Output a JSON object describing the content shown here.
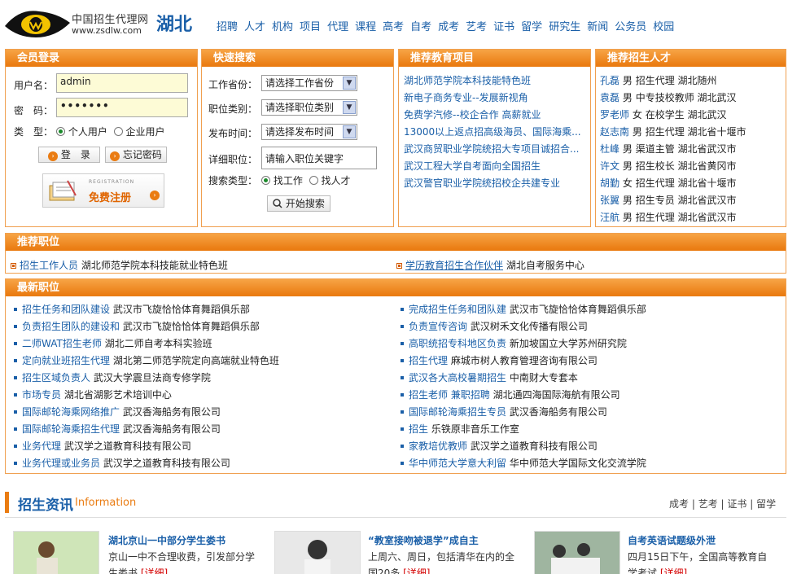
{
  "header": {
    "site_name": "中国招生代理网",
    "url": "www.zsdlw.com",
    "region": "湖北",
    "nav": [
      "招聘",
      "人才",
      "机构",
      "项目",
      "代理",
      "课程",
      "高考",
      "自考",
      "成考",
      "艺考",
      "证书",
      "留学",
      "研究生",
      "新闻",
      "公务员",
      "校园"
    ]
  },
  "login": {
    "title": "会员登录",
    "username_label": "用户名：",
    "username_value": "admin",
    "password_label": "密　码：",
    "password_value": "•••••••",
    "type_label": "类　型：",
    "type_personal": "个人用户",
    "type_company": "企业用户",
    "login_button": "登　录",
    "forgot_button": "忘记密码",
    "register_small": "REGISTRATION",
    "register_label": "免费注册"
  },
  "quick_search": {
    "title": "快速搜索",
    "province_label": "工作省份：",
    "province_value": "请选择工作省份",
    "category_label": "职位类别：",
    "category_value": "请选择职位类别",
    "time_label": "发布时间：",
    "time_value": "请选择发布时间",
    "job_label": "详细职位：",
    "job_placeholder": "请输入职位关键字",
    "type_label": "搜索类型：",
    "type_job": "找工作",
    "type_talent": "找人才",
    "search_button": "开始搜索"
  },
  "edu_projects": {
    "title": "推荐教育项目",
    "items": [
      "湖北师范学院本科技能特色班",
      "新电子商务专业--发展新视角",
      "免费学汽修--校企合作 高薪就业",
      "13000以上返点招高级海员、国际海乘...",
      "武汉商贸职业学院统招大专项目诚招合...",
      "武汉工程大学自考面向全国招生",
      "武汉警官职业学院统招校企共建专业"
    ]
  },
  "talents": {
    "title": "推荐招生人才",
    "items": [
      {
        "name": "孔磊",
        "gender": "男",
        "role": "招生代理",
        "loc": "湖北随州"
      },
      {
        "name": "袁磊",
        "gender": "男",
        "role": "中专技校教师",
        "loc": "湖北武汉"
      },
      {
        "name": "罗老师",
        "gender": "女",
        "role": "在校学生",
        "loc": "湖北武汉"
      },
      {
        "name": "赵志南",
        "gender": "男",
        "role": "招生代理",
        "loc": "湖北省十堰市"
      },
      {
        "name": "杜峰",
        "gender": "男",
        "role": "渠道主管",
        "loc": "湖北省武汉市"
      },
      {
        "name": "许文",
        "gender": "男",
        "role": "招生校长",
        "loc": "湖北省黄冈市"
      },
      {
        "name": "胡勤",
        "gender": "女",
        "role": "招生代理",
        "loc": "湖北省十堰市"
      },
      {
        "name": "张翼",
        "gender": "男",
        "role": "招生专员",
        "loc": "湖北省武汉市"
      },
      {
        "name": "汪航",
        "gender": "男",
        "role": "招生代理",
        "loc": "湖北省武汉市"
      }
    ]
  },
  "recommended_jobs": {
    "title": "推荐职位",
    "items": [
      {
        "job": "招生工作人员",
        "org": "湖北师范学院本科技能就业特色班"
      },
      {
        "job": "学历教育招生合作伙伴",
        "org": "湖北自考服务中心"
      }
    ]
  },
  "latest_jobs": {
    "title": "最新职位",
    "left": [
      {
        "job": "招生任务和团队建设",
        "org": "武汉市飞旋恰恰体育舞蹈俱乐部"
      },
      {
        "job": "负责招生团队的建设和",
        "org": "武汉市飞旋恰恰体育舞蹈俱乐部"
      },
      {
        "job": "二师WAT招生老师",
        "org": "湖北二师自考本科实验班"
      },
      {
        "job": "定向就业班招生代理",
        "org": "湖北第二师范学院定向高端就业特色班"
      },
      {
        "job": "招生区域负责人",
        "org": "武汉大学震旦法商专修学院"
      },
      {
        "job": "市场专员",
        "org": "湖北省湖影艺术培训中心"
      },
      {
        "job": "国际邮轮海乘网络推广",
        "org": "武汉香海船务有限公司"
      },
      {
        "job": "国际邮轮海乘招生代理",
        "org": "武汉香海船务有限公司"
      },
      {
        "job": "业务代理",
        "org": "武汉学之道教育科技有限公司"
      },
      {
        "job": "业务代理或业务员",
        "org": "武汉学之道教育科技有限公司"
      }
    ],
    "right": [
      {
        "job": "完成招生任务和团队建",
        "org": "武汉市飞旋恰恰体育舞蹈俱乐部"
      },
      {
        "job": "负责宣传咨询",
        "org": "武汉树禾文化传播有限公司"
      },
      {
        "job": "高职统招专科地区负责",
        "org": "新加坡国立大学苏州研究院"
      },
      {
        "job": "招生代理",
        "org": "麻城市树人教育管理咨询有限公司"
      },
      {
        "job": "武汉各大高校暑期招生",
        "org": "中南财大专套本"
      },
      {
        "job": "招生老师 兼职招聘",
        "org": "湖北通四海国际海航有限公司"
      },
      {
        "job": "国际邮轮海乘招生专员",
        "org": "武汉香海船务有限公司"
      },
      {
        "job": "招生",
        "org": "乐铁原非音乐工作室"
      },
      {
        "job": "家教培优教师",
        "org": "武汉学之道教育科技有限公司"
      },
      {
        "job": "华中师范大学意大利留",
        "org": "华中师范大学国际文化交流学院"
      }
    ]
  },
  "news": {
    "title": "招生资讯",
    "title_en": "Information",
    "tabs": [
      "成考",
      "艺考",
      "证书",
      "留学"
    ],
    "items": [
      {
        "title": "湖北京山一中部分学生娄书",
        "body1": "京山一中不合理收费，引发部分学",
        "body2": "生娄书",
        "detail": "[详细]"
      },
      {
        "title": "“教室接吻被退学”成自主",
        "body1": "上周六、周日，包括清华在内的全",
        "body2": "国20多",
        "detail": "[详细]"
      },
      {
        "title": "自考英语试题级外泄",
        "body1": "四月15日下午，全国高等教育自",
        "body2": "学考试",
        "detail": "[详细]"
      }
    ]
  },
  "colors": {
    "accent": "#ea7c12",
    "link": "#1a5fa8"
  }
}
